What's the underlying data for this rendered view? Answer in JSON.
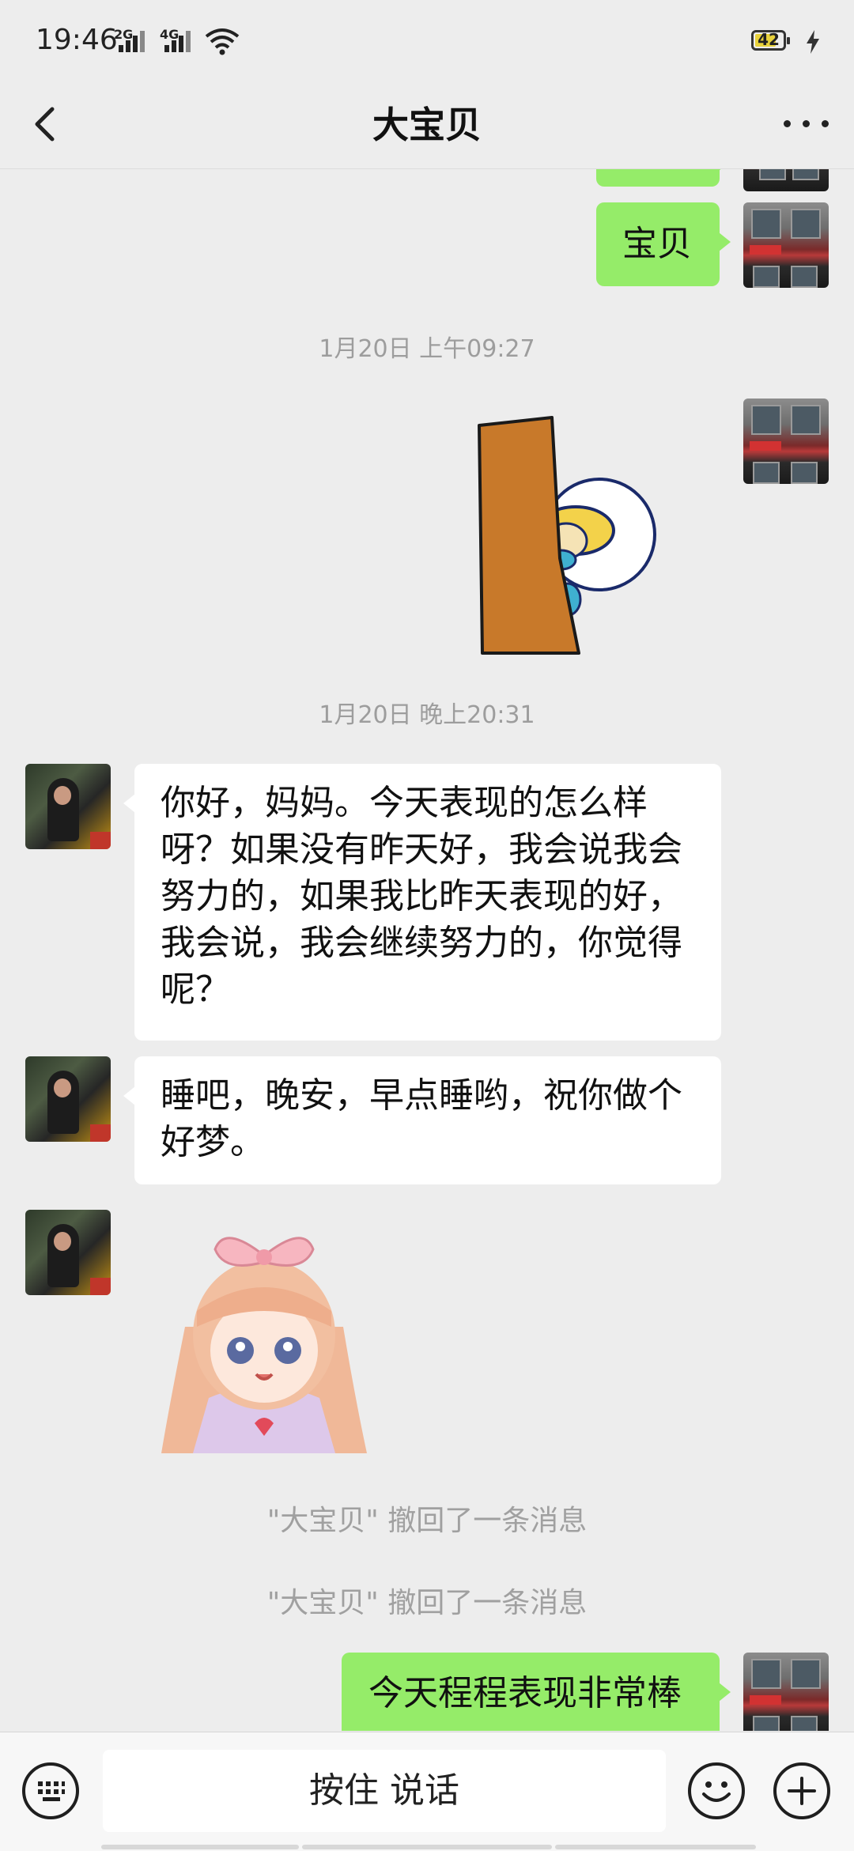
{
  "status_bar": {
    "time": "19:46",
    "network_1": "2G",
    "network_2": "4G",
    "battery": "42"
  },
  "header": {
    "title": "大宝贝",
    "back_icon": "chevron-left-icon",
    "more_icon": "more-dots-icon"
  },
  "messages": {
    "m1_text": "宝贝",
    "ts1": "1月20日 上午09:27",
    "ts2": "1月20日 晚上20:31",
    "m3_text": "你好，妈妈。今天表现的怎么样呀？如果没有昨天好，我会说我会努力的，如果我比昨天表现的好，我会说，我会继续努力的，你觉得呢？",
    "m4_text": "睡吧，晚安，早点睡哟，祝你做个好梦。",
    "recall_1": "\"大宝贝\" 撤回了一条消息",
    "recall_2": "\"大宝贝\" 撤回了一条消息",
    "m6_text": "今天程程表现非常棒"
  },
  "input_bar": {
    "hold_to_talk": "按住 说话",
    "voice_keyboard_icon": "keyboard-icon",
    "emoji_icon": "emoji-icon",
    "plus_icon": "plus-icon"
  },
  "colors": {
    "background": "#ededed",
    "sent_bubble": "#95ec69",
    "received_bubble": "#ffffff",
    "timestamp_text": "#9d9d9d"
  }
}
